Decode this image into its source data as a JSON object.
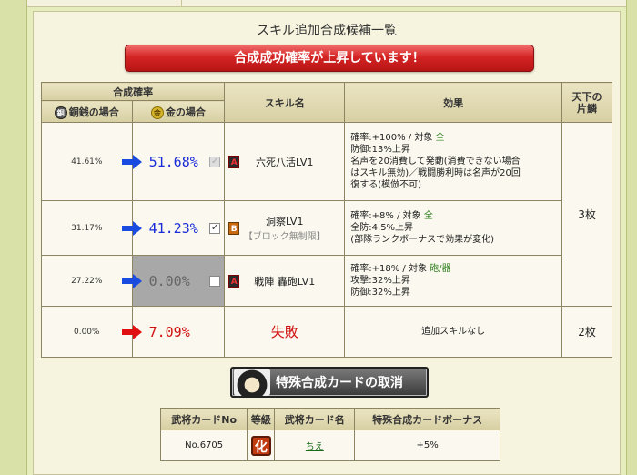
{
  "header": {
    "title": "スキル追加合成候補一覧"
  },
  "banner": {
    "text": "合成成功確率が上昇しています！"
  },
  "table": {
    "group_header": "合成確率",
    "col_copper": "銅銭の場合",
    "col_gold": "金の場合",
    "col_skill": "スキル名",
    "col_effect": "効果",
    "col_heaven": "天下の\n片鱗",
    "copper_icon_char": "銅",
    "gold_icon_char": "金",
    "rows": [
      {
        "copper": "41.61%",
        "gold": "51.68%",
        "checked": "✓",
        "rank": "A",
        "skill": "六死八活LV1",
        "skill_note": "",
        "effect_lines": [
          "確率:+100% / 対象 ",
          "全",
          "防御:13%上昇",
          "名声を20消費して発動(消費できない場合",
          "はスキル無効)／戦闘勝利時は名声が20回",
          "復する(模倣不可)"
        ]
      },
      {
        "copper": "31.17%",
        "gold": "41.23%",
        "checked": "✓",
        "rank": "B",
        "skill": "洞察LV1",
        "skill_note": "【ブロック無制限】",
        "effect_lines": [
          "確率:+8% / 対象 ",
          "全",
          "全防:4.5%上昇",
          "(部隊ランクボーナスで効果が変化)"
        ]
      },
      {
        "copper": "27.22%",
        "gold": "0.00%",
        "checked": "",
        "rank": "A",
        "skill": "戦陣 轟砲LV1",
        "skill_note": "",
        "effect_lines": [
          "確率:+18% / 対象 ",
          "砲/器",
          "攻撃:32%上昇",
          "防御:32%上昇"
        ]
      },
      {
        "copper": "0.00%",
        "gold": "7.09%",
        "fail": "失敗",
        "effect": "追加スキルなし"
      }
    ],
    "heaven_top": "3枚",
    "heaven_bottom": "2枚"
  },
  "cancel_button": {
    "label": "特殊合成カードの取消"
  },
  "card_table": {
    "headers": [
      "武将カードNo",
      "等級",
      "武将カード名",
      "特殊合成カードボーナス"
    ],
    "row": {
      "no": "No.6705",
      "grade": "化",
      "name": "ちえ",
      "bonus": "+5%"
    }
  },
  "colors": {
    "accent_red": "#d01010",
    "accent_blue": "#1a2bd8",
    "banner": "#d42424"
  },
  "icons": [
    "blue-arrow-icon",
    "red-arrow-icon",
    "copper-coin-icon",
    "gold-coin-icon",
    "checkbox-icon",
    "rank-badge-icon",
    "portrait-icon"
  ]
}
